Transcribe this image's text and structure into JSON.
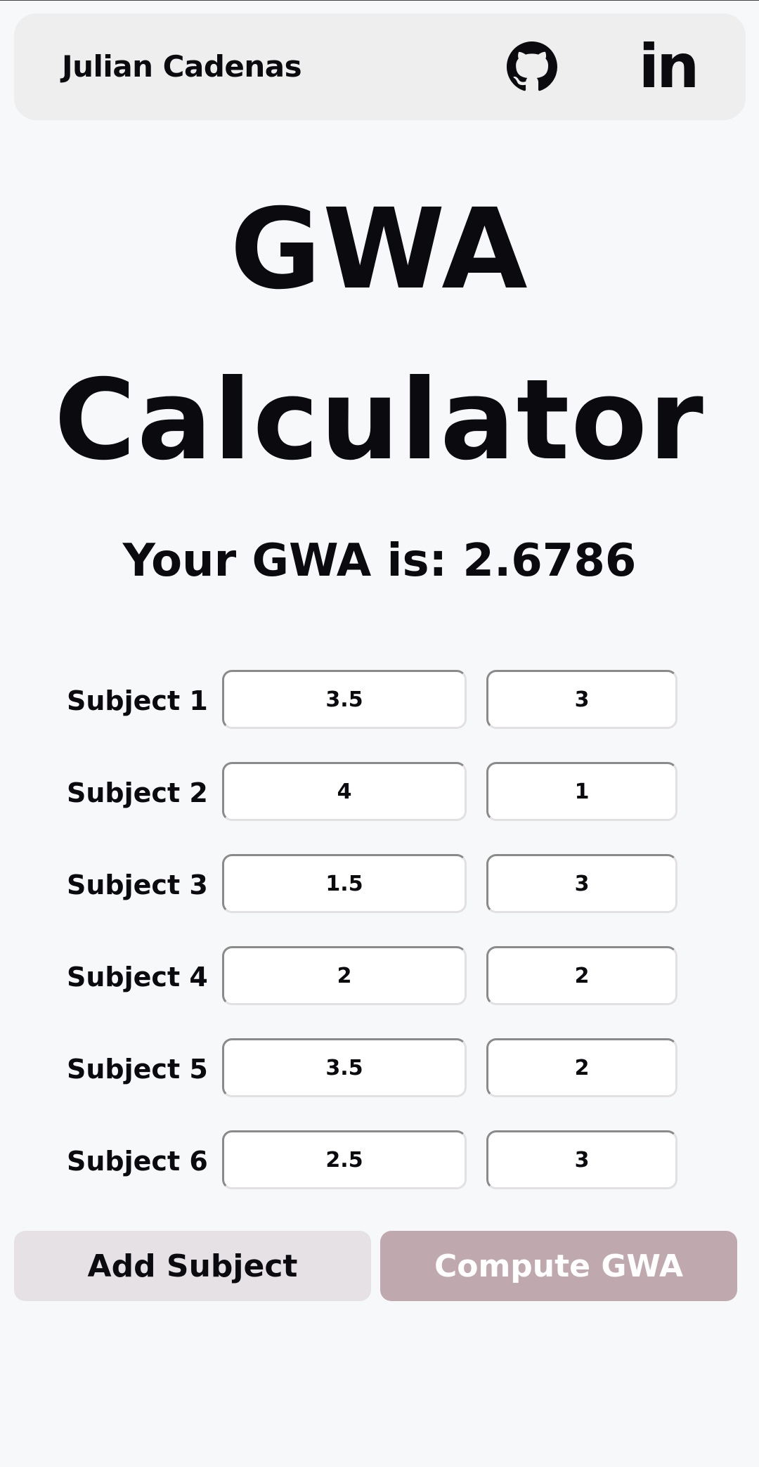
{
  "navbar": {
    "brand": "Julian Cadenas",
    "github_icon": "github-icon",
    "linkedin_icon": "linkedin-icon",
    "linkedin_glyph": "in"
  },
  "title": {
    "line1": "GWA",
    "line2": "Calculator"
  },
  "result_text": "Your GWA is: 2.6786",
  "subjects": [
    {
      "label": "Subject 1",
      "grade": "3.5",
      "units": "3"
    },
    {
      "label": "Subject 2",
      "grade": "4",
      "units": "1"
    },
    {
      "label": "Subject 3",
      "grade": "1.5",
      "units": "3"
    },
    {
      "label": "Subject 4",
      "grade": "2",
      "units": "2"
    },
    {
      "label": "Subject 5",
      "grade": "3.5",
      "units": "2"
    },
    {
      "label": "Subject 6",
      "grade": "2.5",
      "units": "3"
    }
  ],
  "buttons": {
    "add": "Add Subject",
    "compute": "Compute GWA"
  },
  "colors": {
    "background": "#f7f8fa",
    "navbar": "#eeeeee",
    "text": "#0a0a0f",
    "add_button": "#e5e1e4",
    "compute_button": "#bfa9ae"
  }
}
